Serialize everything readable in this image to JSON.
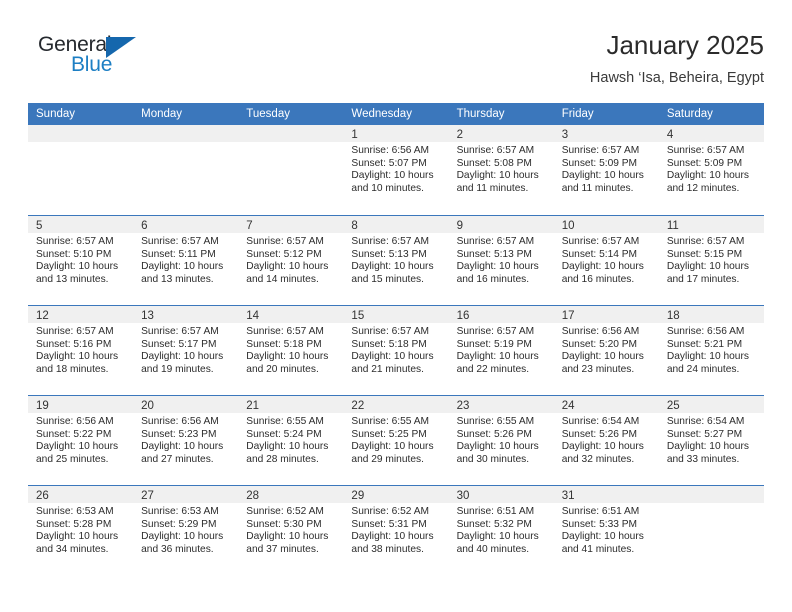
{
  "brand": {
    "name_part1": "General",
    "name_part2": "Blue",
    "accent_color": "#1d7fc4",
    "flag_color": "#1567ad"
  },
  "header": {
    "title": "January 2025",
    "location": "Hawsh ‘Isa, Beheira, Egypt"
  },
  "colors": {
    "header_blue": "#3b77bc",
    "daynum_band": "#f0f0f0",
    "text": "#2c2c2c"
  },
  "weekdays": [
    "Sunday",
    "Monday",
    "Tuesday",
    "Wednesday",
    "Thursday",
    "Friday",
    "Saturday"
  ],
  "weeks": [
    [
      {
        "day": "",
        "lines": []
      },
      {
        "day": "",
        "lines": []
      },
      {
        "day": "",
        "lines": []
      },
      {
        "day": "1",
        "lines": [
          "Sunrise: 6:56 AM",
          "Sunset: 5:07 PM",
          "Daylight: 10 hours",
          "and 10 minutes."
        ]
      },
      {
        "day": "2",
        "lines": [
          "Sunrise: 6:57 AM",
          "Sunset: 5:08 PM",
          "Daylight: 10 hours",
          "and 11 minutes."
        ]
      },
      {
        "day": "3",
        "lines": [
          "Sunrise: 6:57 AM",
          "Sunset: 5:09 PM",
          "Daylight: 10 hours",
          "and 11 minutes."
        ]
      },
      {
        "day": "4",
        "lines": [
          "Sunrise: 6:57 AM",
          "Sunset: 5:09 PM",
          "Daylight: 10 hours",
          "and 12 minutes."
        ]
      }
    ],
    [
      {
        "day": "5",
        "lines": [
          "Sunrise: 6:57 AM",
          "Sunset: 5:10 PM",
          "Daylight: 10 hours",
          "and 13 minutes."
        ]
      },
      {
        "day": "6",
        "lines": [
          "Sunrise: 6:57 AM",
          "Sunset: 5:11 PM",
          "Daylight: 10 hours",
          "and 13 minutes."
        ]
      },
      {
        "day": "7",
        "lines": [
          "Sunrise: 6:57 AM",
          "Sunset: 5:12 PM",
          "Daylight: 10 hours",
          "and 14 minutes."
        ]
      },
      {
        "day": "8",
        "lines": [
          "Sunrise: 6:57 AM",
          "Sunset: 5:13 PM",
          "Daylight: 10 hours",
          "and 15 minutes."
        ]
      },
      {
        "day": "9",
        "lines": [
          "Sunrise: 6:57 AM",
          "Sunset: 5:13 PM",
          "Daylight: 10 hours",
          "and 16 minutes."
        ]
      },
      {
        "day": "10",
        "lines": [
          "Sunrise: 6:57 AM",
          "Sunset: 5:14 PM",
          "Daylight: 10 hours",
          "and 16 minutes."
        ]
      },
      {
        "day": "11",
        "lines": [
          "Sunrise: 6:57 AM",
          "Sunset: 5:15 PM",
          "Daylight: 10 hours",
          "and 17 minutes."
        ]
      }
    ],
    [
      {
        "day": "12",
        "lines": [
          "Sunrise: 6:57 AM",
          "Sunset: 5:16 PM",
          "Daylight: 10 hours",
          "and 18 minutes."
        ]
      },
      {
        "day": "13",
        "lines": [
          "Sunrise: 6:57 AM",
          "Sunset: 5:17 PM",
          "Daylight: 10 hours",
          "and 19 minutes."
        ]
      },
      {
        "day": "14",
        "lines": [
          "Sunrise: 6:57 AM",
          "Sunset: 5:18 PM",
          "Daylight: 10 hours",
          "and 20 minutes."
        ]
      },
      {
        "day": "15",
        "lines": [
          "Sunrise: 6:57 AM",
          "Sunset: 5:18 PM",
          "Daylight: 10 hours",
          "and 21 minutes."
        ]
      },
      {
        "day": "16",
        "lines": [
          "Sunrise: 6:57 AM",
          "Sunset: 5:19 PM",
          "Daylight: 10 hours",
          "and 22 minutes."
        ]
      },
      {
        "day": "17",
        "lines": [
          "Sunrise: 6:56 AM",
          "Sunset: 5:20 PM",
          "Daylight: 10 hours",
          "and 23 minutes."
        ]
      },
      {
        "day": "18",
        "lines": [
          "Sunrise: 6:56 AM",
          "Sunset: 5:21 PM",
          "Daylight: 10 hours",
          "and 24 minutes."
        ]
      }
    ],
    [
      {
        "day": "19",
        "lines": [
          "Sunrise: 6:56 AM",
          "Sunset: 5:22 PM",
          "Daylight: 10 hours",
          "and 25 minutes."
        ]
      },
      {
        "day": "20",
        "lines": [
          "Sunrise: 6:56 AM",
          "Sunset: 5:23 PM",
          "Daylight: 10 hours",
          "and 27 minutes."
        ]
      },
      {
        "day": "21",
        "lines": [
          "Sunrise: 6:55 AM",
          "Sunset: 5:24 PM",
          "Daylight: 10 hours",
          "and 28 minutes."
        ]
      },
      {
        "day": "22",
        "lines": [
          "Sunrise: 6:55 AM",
          "Sunset: 5:25 PM",
          "Daylight: 10 hours",
          "and 29 minutes."
        ]
      },
      {
        "day": "23",
        "lines": [
          "Sunrise: 6:55 AM",
          "Sunset: 5:26 PM",
          "Daylight: 10 hours",
          "and 30 minutes."
        ]
      },
      {
        "day": "24",
        "lines": [
          "Sunrise: 6:54 AM",
          "Sunset: 5:26 PM",
          "Daylight: 10 hours",
          "and 32 minutes."
        ]
      },
      {
        "day": "25",
        "lines": [
          "Sunrise: 6:54 AM",
          "Sunset: 5:27 PM",
          "Daylight: 10 hours",
          "and 33 minutes."
        ]
      }
    ],
    [
      {
        "day": "26",
        "lines": [
          "Sunrise: 6:53 AM",
          "Sunset: 5:28 PM",
          "Daylight: 10 hours",
          "and 34 minutes."
        ]
      },
      {
        "day": "27",
        "lines": [
          "Sunrise: 6:53 AM",
          "Sunset: 5:29 PM",
          "Daylight: 10 hours",
          "and 36 minutes."
        ]
      },
      {
        "day": "28",
        "lines": [
          "Sunrise: 6:52 AM",
          "Sunset: 5:30 PM",
          "Daylight: 10 hours",
          "and 37 minutes."
        ]
      },
      {
        "day": "29",
        "lines": [
          "Sunrise: 6:52 AM",
          "Sunset: 5:31 PM",
          "Daylight: 10 hours",
          "and 38 minutes."
        ]
      },
      {
        "day": "30",
        "lines": [
          "Sunrise: 6:51 AM",
          "Sunset: 5:32 PM",
          "Daylight: 10 hours",
          "and 40 minutes."
        ]
      },
      {
        "day": "31",
        "lines": [
          "Sunrise: 6:51 AM",
          "Sunset: 5:33 PM",
          "Daylight: 10 hours",
          "and 41 minutes."
        ]
      },
      {
        "day": "",
        "lines": []
      }
    ]
  ]
}
